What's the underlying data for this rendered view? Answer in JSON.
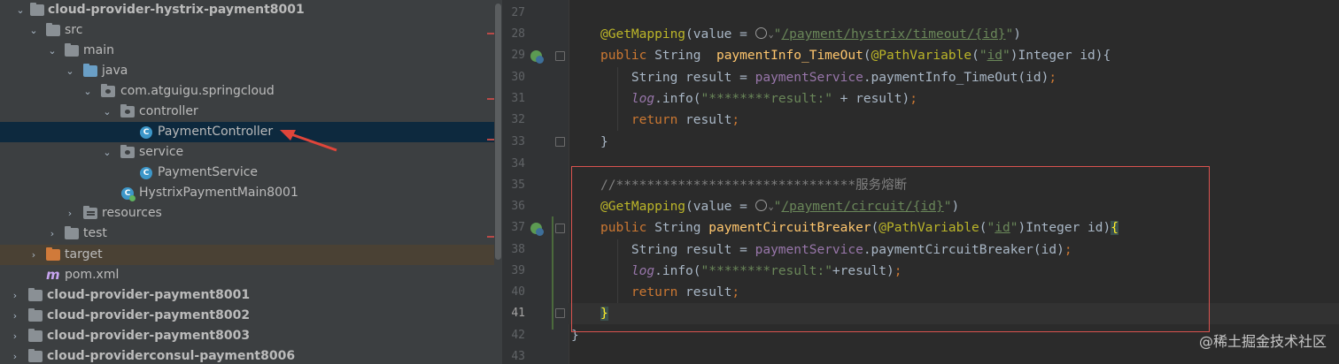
{
  "project_tree": {
    "items": [
      {
        "label": "cloud-provider-hystrix-payment8001",
        "arrow": "⌄",
        "bold": true
      },
      {
        "label": "src",
        "arrow": "⌄"
      },
      {
        "label": "main",
        "arrow": "⌄"
      },
      {
        "label": "java",
        "arrow": "⌄"
      },
      {
        "label": "com.atguigu.springcloud",
        "arrow": "⌄"
      },
      {
        "label": "controller",
        "arrow": "⌄"
      },
      {
        "label": "PaymentController",
        "class_badge": "C"
      },
      {
        "label": "service",
        "arrow": "⌄"
      },
      {
        "label": "PaymentService",
        "class_badge": "C"
      },
      {
        "label": "HystrixPaymentMain8001",
        "class_badge": "C"
      },
      {
        "label": "resources",
        "arrow": "›"
      },
      {
        "label": "test",
        "arrow": "›"
      },
      {
        "label": "target",
        "arrow": "›"
      },
      {
        "label": "pom.xml",
        "file_badge": "m"
      },
      {
        "label": "cloud-provider-payment8001",
        "arrow": "›",
        "bold": true
      },
      {
        "label": "cloud-provider-payment8002",
        "arrow": "›",
        "bold": true
      },
      {
        "label": "cloud-provider-payment8003",
        "arrow": "›",
        "bold": true
      },
      {
        "label": "cloud-providerconsul-payment8006",
        "arrow": "›",
        "bold": true
      }
    ],
    "selected": "PaymentController"
  },
  "editor": {
    "line_numbers": [
      "27",
      "28",
      "29",
      "30",
      "31",
      "32",
      "33",
      "34",
      "35",
      "36",
      "37",
      "38",
      "39",
      "40",
      "41",
      "42",
      "43"
    ],
    "current_line": "41"
  },
  "watermark": "@稀土掘金技术社区",
  "colors": {
    "annotation": "#bbb529",
    "keyword": "#cc7832",
    "string": "#6a8759",
    "highlight_box": "#d9534f"
  }
}
